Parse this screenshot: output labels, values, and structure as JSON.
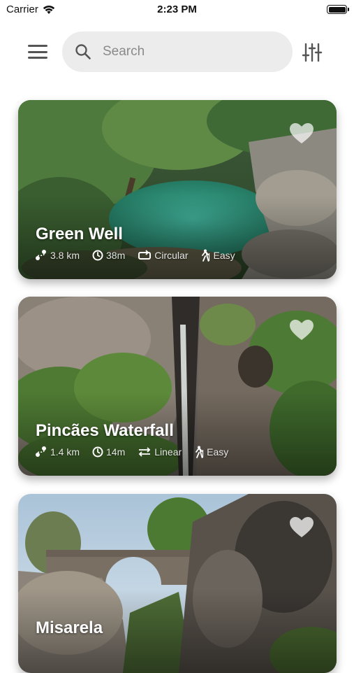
{
  "status_bar": {
    "carrier": "Carrier",
    "time": "2:23 PM"
  },
  "header": {
    "search_placeholder": "Search",
    "icons": [
      "menu-icon",
      "search-icon",
      "filter-sliders-icon"
    ]
  },
  "trails": [
    {
      "name": "Green Well",
      "distance": "3.8 km",
      "duration": "38m",
      "route_type": "Circular",
      "difficulty": "Easy",
      "favorite": false
    },
    {
      "name": "Pincães Waterfall",
      "distance": "1.4 km",
      "duration": "14m",
      "route_type": "Linear",
      "difficulty": "Easy",
      "favorite": false
    },
    {
      "name": "Misarela",
      "favorite": false
    }
  ],
  "colors": {
    "search_bg": "#ececec",
    "icon_gray": "#555555",
    "card_text": "#ffffff"
  }
}
